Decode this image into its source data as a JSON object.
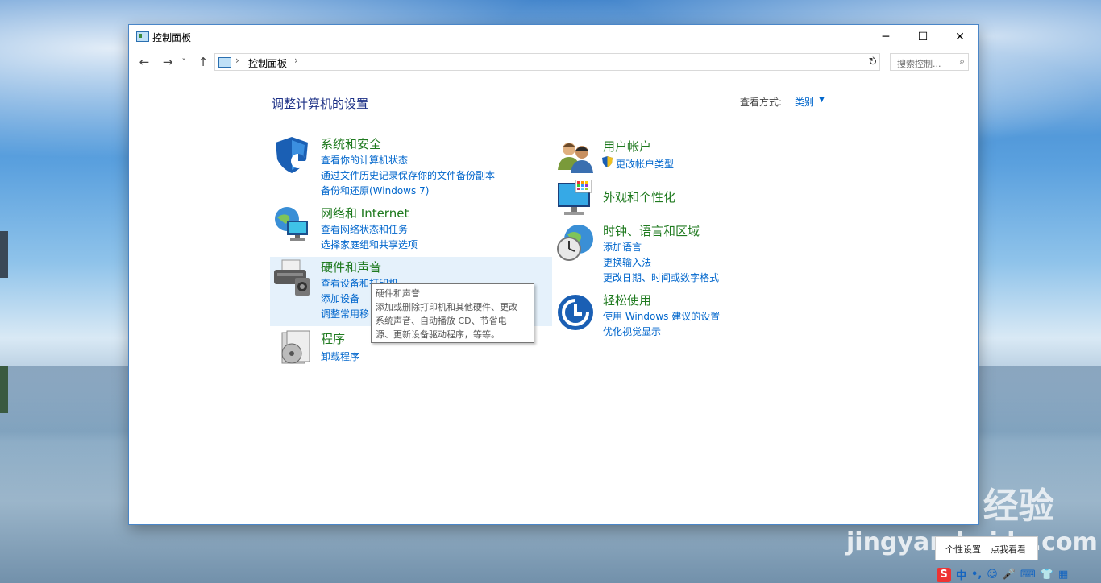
{
  "window": {
    "title": "控制面板",
    "minimize": "─",
    "maximize": "☐",
    "close": "✕"
  },
  "nav": {
    "back": "←",
    "forward": "→",
    "recent": "˅",
    "up": "↑",
    "breadcrumb": "控制面板",
    "sep": "›",
    "dropdown": "˅",
    "refresh": "↻",
    "search_placeholder": "搜索控制...",
    "search_icon": "⌕"
  },
  "main": {
    "heading": "调整计算机的设置",
    "view_by_label": "查看方式:",
    "view_by_value": "类别",
    "view_by_arrow": "▼"
  },
  "categories": {
    "system": {
      "title": "系统和安全",
      "links": [
        "查看你的计算机状态",
        "通过文件历史记录保存你的文件备份副本",
        "备份和还原(Windows 7)"
      ]
    },
    "network": {
      "title": "网络和 Internet",
      "links": [
        "查看网络状态和任务",
        "选择家庭组和共享选项"
      ]
    },
    "hardware": {
      "title": "硬件和声音",
      "links": [
        "查看设备和打印机",
        "添加设备",
        "调整常用移"
      ]
    },
    "programs": {
      "title": "程序",
      "links": [
        "卸载程序"
      ]
    },
    "accounts": {
      "title": "用户帐户",
      "links": [
        "更改帐户类型"
      ]
    },
    "appearance": {
      "title": "外观和个性化",
      "links": []
    },
    "clock": {
      "title": "时钟、语言和区域",
      "links": [
        "添加语言",
        "更换输入法",
        "更改日期、时间或数字格式"
      ]
    },
    "ease": {
      "title": "轻松使用",
      "links": [
        "使用 Windows 建议的设置",
        "优化视觉显示"
      ]
    }
  },
  "tooltip": {
    "title": "硬件和声音",
    "line1": "添加或删除打印机和其他硬件、更改",
    "line2": "系统声音、自动播放 CD、节省电",
    "line3": "源、更新设备驱动程序，等等。"
  },
  "watermark": {
    "baidu": "Bai du 经验",
    "jingyan": "jingyan.baidu.com"
  },
  "tray": {
    "bubble_left": "个性设置",
    "bubble_right": "点我看看",
    "ime_logo": "S",
    "ime_lang": "中",
    "ime_items": [
      "•,",
      "☺",
      "🎤",
      "⌨",
      "👕",
      "▦"
    ]
  },
  "colors": {
    "link": "#0066cc",
    "category_title": "#1f7a1f",
    "heading": "#1e3287",
    "hover_bg": "#e5f1fb"
  }
}
